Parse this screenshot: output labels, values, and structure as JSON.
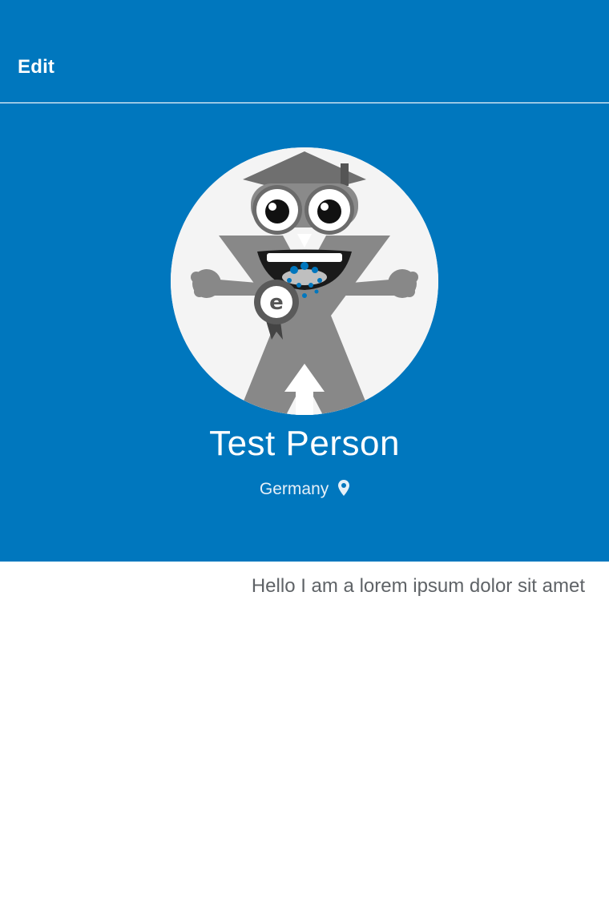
{
  "header": {
    "edit_label": "Edit"
  },
  "profile": {
    "name": "Test Person",
    "location": "Germany",
    "bio": "Hello I am a lorem ipsum dolor sit amet",
    "avatar_icon": "mascot-avatar",
    "location_icon": "map-pin-icon"
  },
  "colors": {
    "primary": "#0077be",
    "text_on_primary": "#ffffff",
    "bio_text": "#5f6367",
    "background": "#ffffff"
  }
}
